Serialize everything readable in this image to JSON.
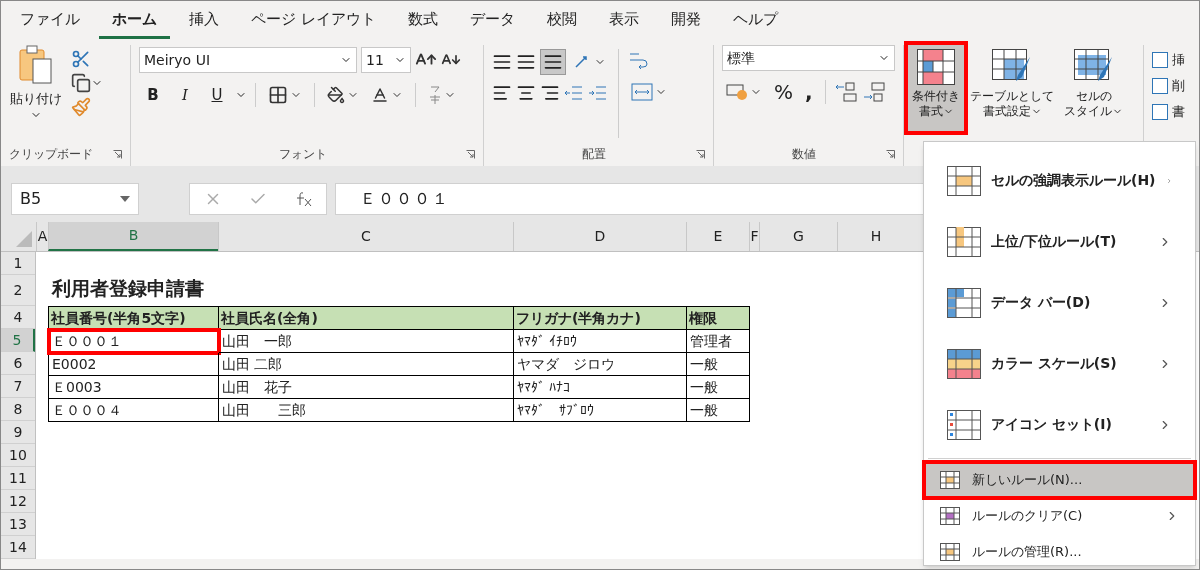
{
  "tabs": [
    {
      "label": "ファイル",
      "selected": false
    },
    {
      "label": "ホーム",
      "selected": true
    },
    {
      "label": "挿入",
      "selected": false
    },
    {
      "label": "ページ レイアウト",
      "selected": false
    },
    {
      "label": "数式",
      "selected": false
    },
    {
      "label": "データ",
      "selected": false
    },
    {
      "label": "校閲",
      "selected": false
    },
    {
      "label": "表示",
      "selected": false
    },
    {
      "label": "開発",
      "selected": false
    },
    {
      "label": "ヘルプ",
      "selected": false
    }
  ],
  "ribbon": {
    "clipboard": {
      "label": "クリップボード",
      "paste": "貼り付け"
    },
    "font": {
      "label": "フォント",
      "name": "Meiryo UI",
      "size": "11",
      "bold": "B",
      "italic": "I",
      "underline": "U"
    },
    "alignment": {
      "label": "配置"
    },
    "number": {
      "label": "数値",
      "format": "標準",
      "percent": "%",
      "comma": ","
    },
    "styles": [
      {
        "line1": "条件付き",
        "line2": "書式",
        "selected": true,
        "red_frame": true
      },
      {
        "line1": "テーブルとして",
        "line2": "書式設定",
        "selected": false,
        "red_frame": false
      },
      {
        "line1": "セルの",
        "line2": "スタイル",
        "selected": false,
        "red_frame": false
      }
    ],
    "cells": [
      "挿",
      "削",
      "書"
    ]
  },
  "formula_bar": {
    "name_box": "B5",
    "formula": "Ｅ０００１"
  },
  "sheet": {
    "columns": [
      {
        "label": "A",
        "selected": false
      },
      {
        "label": "B",
        "selected": true
      },
      {
        "label": "C",
        "selected": false
      },
      {
        "label": "D",
        "selected": false
      },
      {
        "label": "E",
        "selected": false
      },
      {
        "label": "F",
        "selected": false
      },
      {
        "label": "G",
        "selected": false
      },
      {
        "label": "H",
        "selected": false
      }
    ],
    "row_numbers": [
      {
        "label": "1",
        "selected": false
      },
      {
        "label": "2",
        "selected": false
      },
      {
        "label": "4",
        "selected": false
      },
      {
        "label": "5",
        "selected": true
      },
      {
        "label": "6",
        "selected": false
      },
      {
        "label": "7",
        "selected": false
      },
      {
        "label": "8",
        "selected": false
      },
      {
        "label": "9",
        "selected": false
      },
      {
        "label": "10",
        "selected": false
      },
      {
        "label": "11",
        "selected": false
      },
      {
        "label": "12",
        "selected": false
      },
      {
        "label": "13",
        "selected": false
      },
      {
        "label": "14",
        "selected": false
      }
    ],
    "title": "利用者登録申請書",
    "table": {
      "columns": [
        "社員番号(半角5文字)",
        "社員氏名(全角)",
        "フリガナ(半角カナ)",
        "権限"
      ],
      "rows": [
        {
          "cells": [
            "Ｅ０００１",
            "山田　一郎",
            "ﾔﾏﾀﾞ ｲﾁﾛｳ",
            "管理者"
          ],
          "selected": true,
          "red_frame": true
        },
        {
          "cells": [
            "E0002",
            "山田 二郎",
            "ヤマダ　ジロウ",
            "一般"
          ],
          "selected": false,
          "red_frame": false
        },
        {
          "cells": [
            "Ｅ0003",
            "山田　花子",
            "ﾔﾏﾀﾞ ﾊﾅｺ",
            "一般"
          ],
          "selected": false,
          "red_frame": false
        },
        {
          "cells": [
            "Ｅ０００４",
            "山田　　三郎",
            "ﾔﾏﾀﾞ　ｻﾌﾞﾛｳ",
            "一般"
          ],
          "selected": false,
          "red_frame": false
        }
      ]
    }
  },
  "menu": {
    "items": [
      {
        "kind": "large",
        "label": "セルの強調表示ルール(H)",
        "submenu": true,
        "selected": false,
        "red_frame": false
      },
      {
        "kind": "large",
        "label": "上位/下位ルール(T)",
        "submenu": true,
        "selected": false,
        "red_frame": false
      },
      {
        "kind": "large",
        "label": "データ バー(D)",
        "submenu": true,
        "selected": false,
        "red_frame": false
      },
      {
        "kind": "large",
        "label": "カラー スケール(S)",
        "submenu": true,
        "selected": false,
        "red_frame": false
      },
      {
        "kind": "large",
        "label": "アイコン セット(I)",
        "submenu": true,
        "selected": false,
        "red_frame": false
      },
      {
        "kind": "small",
        "label": "新しいルール(N)...",
        "submenu": false,
        "selected": true,
        "red_frame": true
      },
      {
        "kind": "small",
        "label": "ルールのクリア(C)",
        "submenu": true,
        "selected": false,
        "red_frame": false
      },
      {
        "kind": "small",
        "label": "ルールの管理(R)...",
        "submenu": false,
        "selected": false,
        "red_frame": false
      }
    ]
  }
}
